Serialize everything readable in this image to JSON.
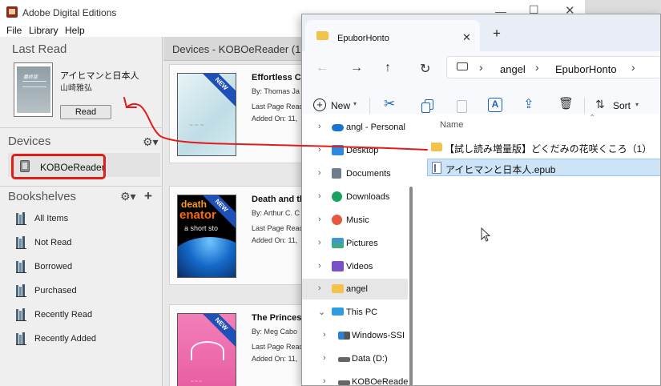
{
  "ade": {
    "title": "Adobe Digital Editions",
    "menu": {
      "file": "File",
      "library": "Library",
      "help": "Help"
    },
    "sidebar": {
      "last_read_title": "Last Read",
      "last_read_book": {
        "title": "アイヒマンと日本人",
        "author": "山崎雅弘",
        "cover_tag": "最終版"
      },
      "read_button": "Read",
      "devices_title": "Devices",
      "device_name": "KOBOeReader",
      "bookshelves_title": "Bookshelves",
      "shelves": [
        {
          "label": "All Items"
        },
        {
          "label": "Not Read"
        },
        {
          "label": "Borrowed"
        },
        {
          "label": "Purchased"
        },
        {
          "label": "Recently Read"
        },
        {
          "label": "Recently Added"
        }
      ]
    },
    "main": {
      "title": "Devices - KOBOeReader (17",
      "new_badge": "NEW",
      "books": [
        {
          "title": "Effortless Ch",
          "author": "By:  Thomas Ja",
          "last_page": "Last Page Read",
          "added": "Added On:  11,"
        },
        {
          "title": "Death and th",
          "author": "By:  Arthur C. C",
          "last_page": "Last Page Read",
          "added": "Added On:  11,",
          "cover_line1": "death",
          "cover_line2": "enator",
          "cover_line3": "a short sto"
        },
        {
          "title": "The Princess",
          "author": "By:  Meg Cabo",
          "last_page": "Last Page Read",
          "added": "Added On:  11,"
        }
      ]
    }
  },
  "explorer": {
    "tab_label": "EpuborHonto",
    "breadcrumbs": [
      "angel",
      "EpuborHonto"
    ],
    "toolbar": {
      "new_label": "New",
      "sort_label": "Sort"
    },
    "tree": [
      {
        "label": "angl - Personal",
        "icon": "onedrive-icon",
        "sub": false
      },
      {
        "label": "Desktop",
        "icon": "desktop-icon",
        "sub": false
      },
      {
        "label": "Documents",
        "icon": "documents-icon",
        "sub": false
      },
      {
        "label": "Downloads",
        "icon": "downloads-icon",
        "sub": false
      },
      {
        "label": "Music",
        "icon": "music-icon",
        "sub": false
      },
      {
        "label": "Pictures",
        "icon": "pictures-icon",
        "sub": false
      },
      {
        "label": "Videos",
        "icon": "videos-icon",
        "sub": false
      },
      {
        "label": "angel",
        "icon": "folder-icon",
        "sub": false,
        "selected": true
      },
      {
        "label": "This PC",
        "icon": "this-pc-icon",
        "sub": false,
        "expanded": true
      },
      {
        "label": "Windows-SSI",
        "icon": "windows-drive-icon",
        "sub": true
      },
      {
        "label": "Data (D:)",
        "icon": "drive-icon",
        "sub": true
      },
      {
        "label": "KOBOeReade",
        "icon": "drive-icon",
        "sub": true
      }
    ],
    "column_name": "Name",
    "files": [
      {
        "label": "【試し読み増量版】どくだみの花咲くころ（1）",
        "type": "folder"
      },
      {
        "label": "アイヒマンと日本人.epub",
        "type": "epub",
        "selected": true
      }
    ]
  },
  "colors": {
    "annotation_red": "#e21b1b",
    "new_badge_blue": "#1f4fb8",
    "selection_blue": "#cde4f7",
    "folder_yellow": "#f3c24b"
  }
}
